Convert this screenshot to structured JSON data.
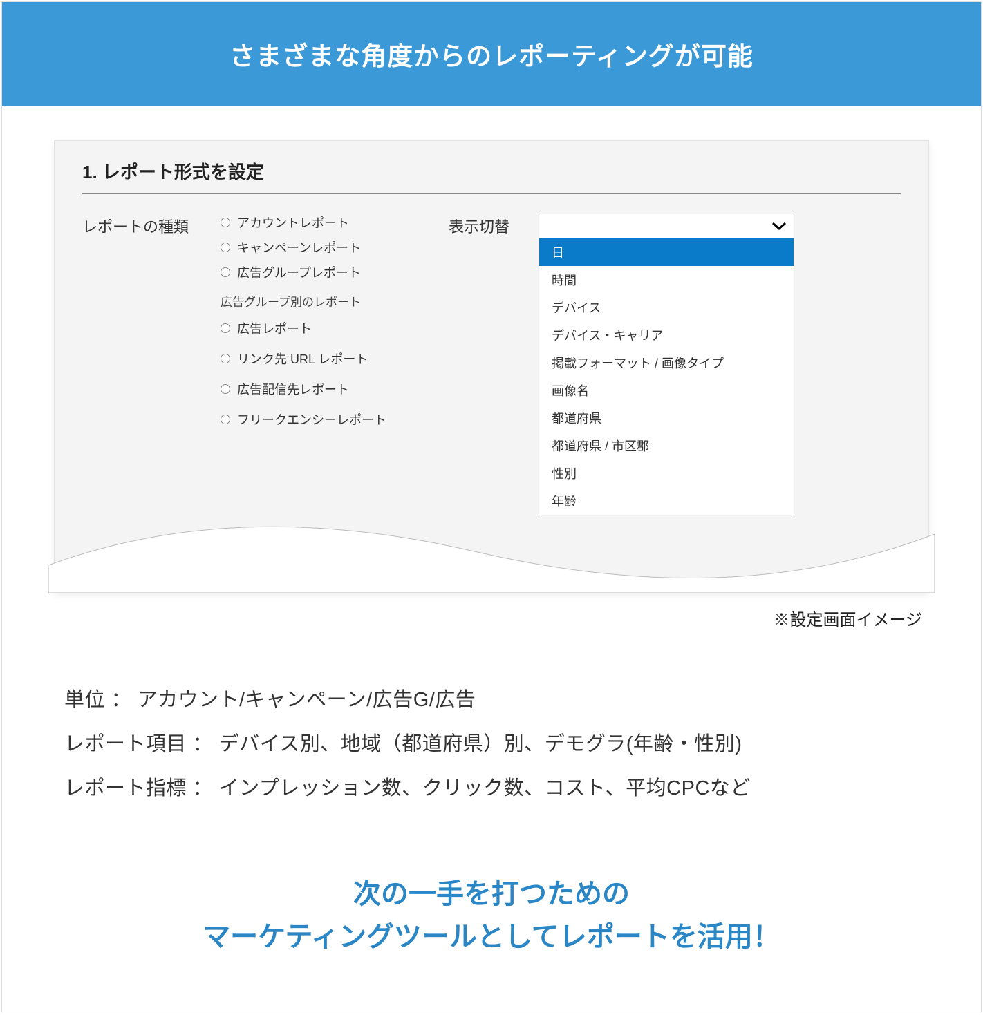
{
  "banner": "さまざまな角度からのレポーティングが可能",
  "panel": {
    "title": "1. レポート形式を設定",
    "report_type_label": "レポートの種類",
    "radios_top": [
      "アカウントレポート",
      "キャンペーンレポート",
      "広告グループレポート"
    ],
    "sub_heading": "広告グループ別のレポート",
    "radios_bottom": [
      "広告レポート",
      "リンク先 URL レポート",
      "広告配信先レポート",
      "フリークエンシーレポート"
    ],
    "switch_label": "表示切替",
    "dropdown": {
      "selected": "日",
      "options": [
        "日",
        "時間",
        "デバイス",
        "デバイス・キャリア",
        "掲載フォーマット / 画像タイプ",
        "画像名",
        "都道府県",
        "都道府県 / 市区郡",
        "性別",
        "年齢"
      ]
    }
  },
  "note": "※設定画面イメージ",
  "descriptions": [
    "単位 ： アカウント/キャンペーン/広告G/広告",
    "レポート項目 ： デバイス別、地域（都道府県）別、デモグラ(年齢・性別)",
    "レポート指標 ： インプレッション数、クリック数、コスト、平均CPCなど"
  ],
  "tagline_line1": "次の一手を打つための",
  "tagline_line2": "マーケティングツールとしてレポートを活用！"
}
